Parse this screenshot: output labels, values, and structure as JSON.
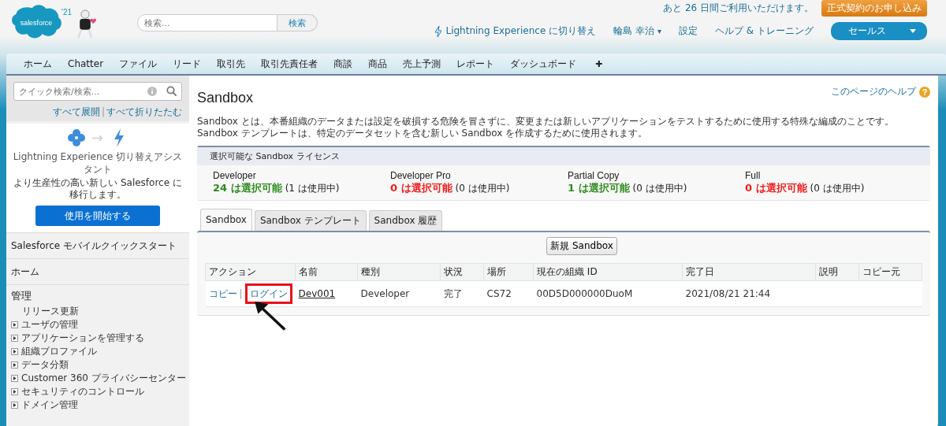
{
  "header": {
    "logo_text": "salesforce",
    "year_badge": "'21",
    "search": {
      "placeholder": "検索...",
      "button": "検索"
    },
    "trial_notice": "あと 26 日間ご利用いただけます。",
    "trial_button": "正式契約のお申し込み",
    "links": [
      {
        "kind": "lightning",
        "label": "Lightning Experience に切り替え"
      },
      {
        "kind": "user",
        "label": "輪島 幸治",
        "caret": "▾"
      },
      {
        "kind": "plain",
        "label": "設定"
      },
      {
        "kind": "plain",
        "label": "ヘルプ & トレーニング"
      }
    ],
    "app_menu": "セールス"
  },
  "nav_tabs": [
    {
      "label": "ホーム",
      "kind": "text"
    },
    {
      "label": "Chatter",
      "kind": "text"
    },
    {
      "label": "ファイル",
      "kind": "text"
    },
    {
      "label": "リード",
      "kind": "text"
    },
    {
      "label": "取引先",
      "kind": "text"
    },
    {
      "label": "取引先責任者",
      "kind": "text"
    },
    {
      "label": "商談",
      "kind": "text"
    },
    {
      "label": "商品",
      "kind": "text"
    },
    {
      "label": "売上予測",
      "kind": "text"
    },
    {
      "label": "レポート",
      "kind": "text"
    },
    {
      "label": "ダッシュボード",
      "kind": "text"
    },
    {
      "label": "✚",
      "kind": "add"
    }
  ],
  "sidebar": {
    "search": {
      "placeholder": "クイック検索/検索..."
    },
    "expand_all": "すべて展開",
    "collapse_all": "すべて折りたたむ",
    "separator": "|",
    "assistant": {
      "title": "Lightning Experience 切り替えアシスタント",
      "text": "より生産性の高い新しい Salesforce に移行します。",
      "button": "使用を開始する"
    },
    "sections": [
      "Salesforce モバイルクイックスタート",
      "ホーム"
    ],
    "admin": {
      "title": "管理",
      "items": [
        {
          "label": "リリース更新",
          "kind": "link"
        },
        {
          "label": "ユーザの管理",
          "kind": "folder",
          "expanded": false
        },
        {
          "label": "アプリケーションを管理する",
          "kind": "folder",
          "expanded": false
        },
        {
          "label": "組織プロファイル",
          "kind": "folder",
          "expanded": false
        },
        {
          "label": "データ分類",
          "kind": "folder",
          "expanded": false
        },
        {
          "label": "Customer 360 プライバシーセンター",
          "kind": "folder",
          "expanded": false
        },
        {
          "label": "セキュリティのコントロール",
          "kind": "folder",
          "expanded": false
        },
        {
          "label": "ドメイン管理",
          "kind": "folder",
          "expanded": false
        }
      ]
    }
  },
  "page": {
    "title": "Sandbox",
    "help_link": "このページのヘルプ",
    "help_icon": "?",
    "description": "Sandbox とは、本番組織のデータまたは設定を破損する危険を冒さずに、変更または新しいアプリケーションをテストするために使用する特殊な編成のことです。Sandbox テンプレートは、特定のデータセットを含む新しい Sandbox を作成するために使用されます。",
    "licenses": {
      "title": "選択可能な Sandbox ライセンス",
      "items": [
        {
          "name": "Developer",
          "available": "24 は選択可能",
          "used": "(1 は使用中)",
          "color": "#2e8b1f"
        },
        {
          "name": "Developer Pro",
          "available": "0 は選択可能",
          "used": "(0 は使用中)",
          "color": "#ee1c1c"
        },
        {
          "name": "Partial Copy",
          "available": "1 は選択可能",
          "used": "(0 は使用中)",
          "color": "#2e8b1f"
        },
        {
          "name": "Full",
          "available": "0 は選択可能",
          "used": "(0 は使用中)",
          "color": "#ee1c1c"
        }
      ]
    },
    "tabs": [
      {
        "label": "Sandbox",
        "selected": true
      },
      {
        "label": "Sandbox テンプレート",
        "selected": false
      },
      {
        "label": "Sandbox 履歴",
        "selected": false
      }
    ],
    "new_button": "新規 Sandbox",
    "table": {
      "columns": [
        "アクション",
        "名前",
        "種別",
        "状況",
        "場所",
        "現在の組織 ID",
        "完了日",
        "説明",
        "コピー元"
      ],
      "rows": [
        {
          "action_separator": "|",
          "actions": [
            {
              "label": "コピー",
              "highlighted": false
            },
            {
              "label": "ログイン",
              "highlighted": true
            }
          ],
          "name": "Dev001",
          "type": "Developer",
          "status": "完了",
          "location": "CS72",
          "org_id": "00D5D000000DuoM",
          "completed": "2021/08/21 21:44"
        }
      ]
    }
  }
}
